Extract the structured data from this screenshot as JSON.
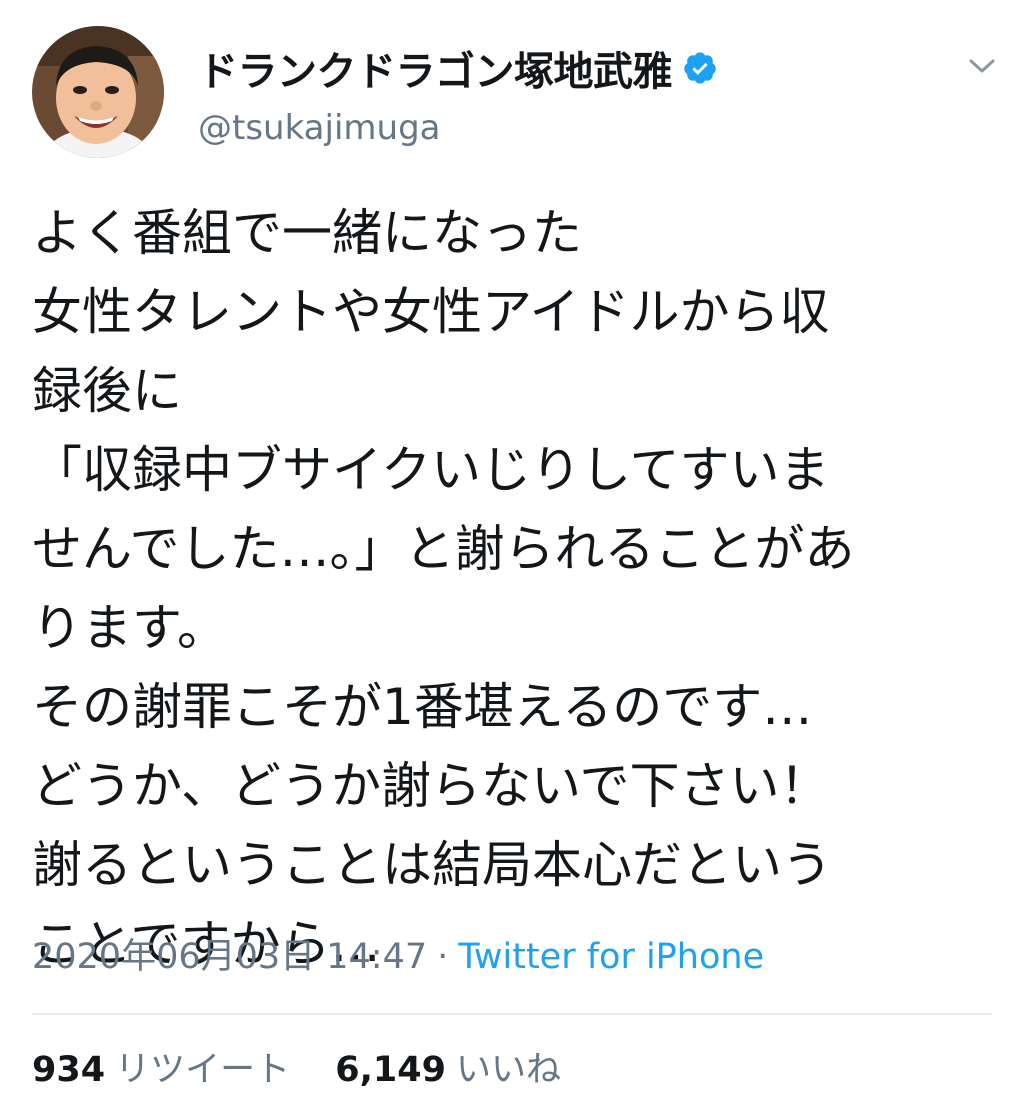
{
  "user": {
    "display_name": "ドランクドラゴン塚地武雅",
    "handle": "@tsukajimuga",
    "verified": true,
    "avatar_icon": "user-avatar-photo"
  },
  "tweet": {
    "lines": [
      "よく番組で一緒になった",
      "女性タレントや女性アイドルから収",
      "録後に",
      "「収録中ブサイクいじりしてすいま",
      "せんでした…。」と謝られることがあ",
      "ります。",
      "その謝罪こそが1番堪えるのです…",
      "どうか、どうか謝らないで下さい！",
      "謝るということは結局本心だという",
      "ことですから…"
    ]
  },
  "meta": {
    "timestamp": "2020年06月03日 14:47",
    "separator": "·",
    "source": "Twitter for iPhone"
  },
  "stats": {
    "retweets_count": "934",
    "retweets_label": "リツイート",
    "likes_count": "6,149",
    "likes_label": "いいね"
  },
  "icons": {
    "verified": "verified-badge-icon",
    "menu": "chevron-down-icon"
  },
  "colors": {
    "text": "#14171a",
    "secondary": "#657786",
    "link": "#1da1f2",
    "divider": "#e6ecf0"
  }
}
